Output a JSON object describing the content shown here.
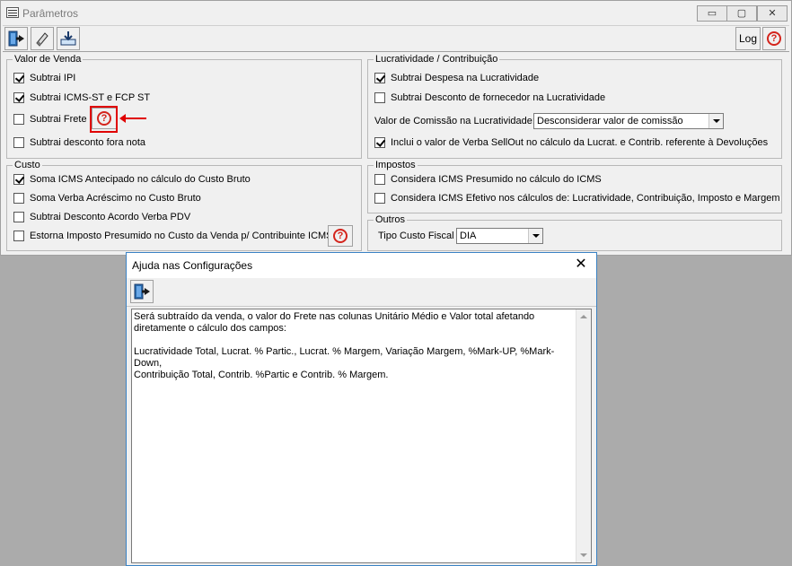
{
  "window": {
    "title": "Parâmetros",
    "log_label": "Log",
    "controls": {
      "minimize": "▭",
      "maximize": "▢",
      "close": "✕"
    }
  },
  "valor_venda": {
    "legend": "Valor de Venda",
    "items": [
      {
        "label": "Subtrai IPI",
        "checked": true
      },
      {
        "label": "Subtrai ICMS-ST e FCP ST",
        "checked": true
      },
      {
        "label": "Subtrai Frete",
        "checked": false
      },
      {
        "label": "Subtrai desconto fora nota",
        "checked": false
      }
    ]
  },
  "custo": {
    "legend": "Custo",
    "items": [
      {
        "label": "Soma ICMS Antecipado no cálculo do Custo Bruto",
        "checked": true
      },
      {
        "label": "Soma Verba Acréscimo no Custo Bruto",
        "checked": false
      },
      {
        "label": "Subtrai Desconto Acordo Verba PDV",
        "checked": false
      },
      {
        "label": "Estorna Imposto Presumido no Custo da Venda p/ Contribuinte ICMS",
        "checked": false
      }
    ]
  },
  "lucratividade": {
    "legend": "Lucratividade / Contribuição",
    "items": [
      {
        "label": "Subtrai Despesa na Lucratividade",
        "checked": true
      },
      {
        "label": "Subtrai Desconto de fornecedor na Lucratividade",
        "checked": false
      },
      {
        "label": "Inclui o valor de Verba SellOut no cálculo da Lucrat. e Contrib. referente à Devoluções",
        "checked": true
      }
    ],
    "comissao_label": "Valor de Comissão na Lucratividade:",
    "comissao_value": "Desconsiderar valor de comissão"
  },
  "impostos": {
    "legend": "Impostos",
    "items": [
      {
        "label": "Considera ICMS Presumido no cálculo do ICMS",
        "checked": false
      },
      {
        "label": "Considera ICMS Efetivo nos cálculos de: Lucratividade, Contribuição, Imposto e Margem",
        "checked": false
      }
    ]
  },
  "outros": {
    "legend": "Outros",
    "tipo_label": "Tipo Custo Fiscal",
    "tipo_value": "DIA"
  },
  "dialog": {
    "title": "Ajuda nas Configurações",
    "close": "✕",
    "text": "Será subtraído da venda, o valor do Frete nas colunas Unitário Médio e Valor total afetando\ndiretamente o cálculo dos campos:\n\nLucratividade Total, Lucrat. % Partic., Lucrat. % Margem, Variação Margem, %Mark-UP, %Mark-Down,\nContribuição Total, Contrib. %Partic e Contrib. % Margem."
  },
  "help_glyph": "?",
  "accent": {
    "red": "#e00000",
    "help_red": "#d4241c",
    "dialog_border": "#3a82c4"
  }
}
